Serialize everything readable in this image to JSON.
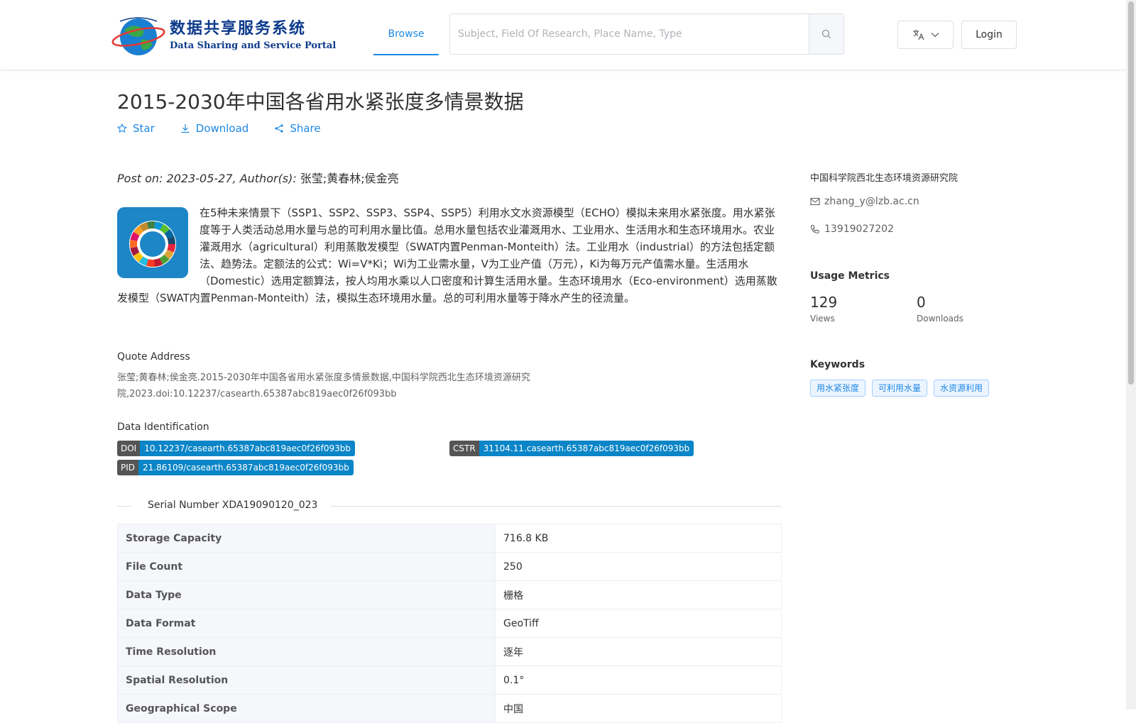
{
  "header": {
    "logo_cn": "数据共享服务系统",
    "logo_en": "Data Sharing and Service Portal",
    "nav_browse": "Browse",
    "search_placeholder": "Subject, Field Of Research, Place Name, Type",
    "login": "Login"
  },
  "dataset": {
    "title": "2015-2030年中国各省用水紧张度多情景数据",
    "actions": {
      "star": "Star",
      "download": "Download",
      "share": "Share"
    },
    "post_label": "Post on: 2023-05-27, Author(s):",
    "authors": "张莹;黄春林;侯金亮",
    "description": "在5种未来情景下（SSP1、SSP2、SSP3、SSP4、SSP5）利用水文水资源模型（ECHO）模拟未来用水紧张度。用水紧张度等于人类活动总用水量与总的可利用水量比值。总用水量包括农业灌溉用水、工业用水、生活用水和生态环境用水。农业灌溉用水（agricultural）利用蒸散发模型（SWAT内置Penman-Monteith）法。工业用水（industrial）的方法包括定额法、趋势法。定额法的公式：Wi=V*Ki；Wi为工业需水量，V为工业产值（万元），Ki为每万元产值需水量。生活用水（Domestic）选用定额算法，按人均用水乘以人口密度和计算生活用水量。生态环境用水（Eco-environment）选用蒸散发模型（SWAT内置Penman-Monteith）法，模拟生态环境用水量。总的可利用水量等于降水产生的径流量。",
    "quote_label": "Quote Address",
    "quote": "张莹;黄春林;侯金亮.2015-2030年中国各省用水紧张度多情景数据,中国科学院西北生态环境资源研究院,2023.doi:10.12237/casearth.65387abc819aec0f26f093bb",
    "identification_label": "Data Identification",
    "doi_key": "DOI",
    "doi": "10.12237/casearth.65387abc819aec0f26f093bb",
    "cstr_key": "CSTR",
    "cstr": "31104.11.casearth.65387abc819aec0f26f093bb",
    "pid_key": "PID",
    "pid": "21.86109/casearth.65387abc819aec0f26f093bb",
    "serial": "Serial Number XDA19090120_023",
    "info_rows": [
      {
        "key": "Storage Capacity",
        "value": "716.8 KB"
      },
      {
        "key": "File Count",
        "value": "250"
      },
      {
        "key": "Data Type",
        "value": "栅格"
      },
      {
        "key": "Data Format",
        "value": "GeoTiff"
      },
      {
        "key": "Time Resolution",
        "value": "逐年"
      },
      {
        "key": "Spatial Resolution",
        "value": "0.1°"
      },
      {
        "key": "Geographical Scope",
        "value": "中国"
      }
    ]
  },
  "sidebar": {
    "org": "中国科学院西北生态环境资源研究院",
    "email": "zhang_y@lzb.ac.cn",
    "phone": "13919027202",
    "usage_title": "Usage Metrics",
    "views": "129",
    "views_label": "Views",
    "downloads": "0",
    "downloads_label": "Downloads",
    "keywords_title": "Keywords",
    "keywords": [
      "用水紧张度",
      "可利用水量",
      "水资源利用"
    ]
  },
  "icons": {
    "star": "star-icon",
    "download": "download-icon",
    "share": "share-icon",
    "search": "search-icon",
    "language": "translate-icon",
    "mail": "mail-icon",
    "phone": "phone-icon"
  },
  "colors": {
    "accent": "#1e88e5",
    "badge_key": "#555555",
    "badge_value": "#0a85c7",
    "logo_text": "#0d3a8c"
  }
}
